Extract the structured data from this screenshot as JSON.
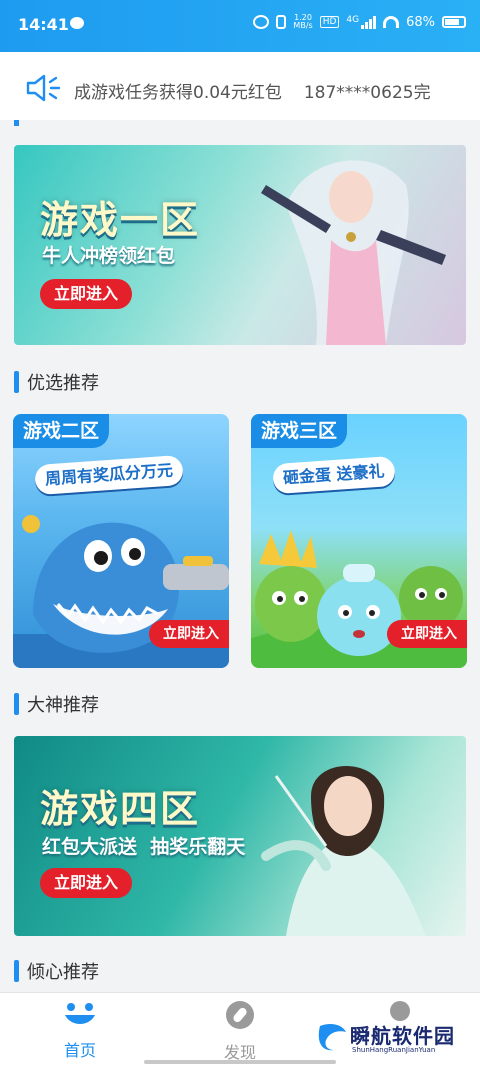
{
  "status_bar": {
    "time": "14:41",
    "speed_top": "1.20",
    "speed_bottom": "MB/s",
    "hd": "HD",
    "network": "4G",
    "battery": "68%"
  },
  "marquee": {
    "text_1": "成游戏任务获得0.04元红包",
    "text_2": "187****0625完"
  },
  "banner_1": {
    "title": "游戏一区",
    "subtitle": "牛人冲榜领红包",
    "button": "立即进入"
  },
  "section_1": {
    "label": "优选推荐"
  },
  "card_2": {
    "tag": "游戏二区",
    "slogan": "周周有奖瓜分万元",
    "button": "立即进入"
  },
  "card_3": {
    "tag": "游戏三区",
    "slogan": "砸金蛋 送豪礼",
    "button": "立即进入"
  },
  "section_2": {
    "label": "大神推荐"
  },
  "banner_4": {
    "title": "游戏四区",
    "subtitle": "红包大派送  抽奖乐翻天",
    "button": "立即进入"
  },
  "section_3": {
    "label": "倾心推荐"
  },
  "bottom_nav": {
    "home": "首页",
    "discover": "发现"
  },
  "watermark": {
    "text": "瞬航软件园",
    "sub": "ShunHangRuanJianYuan"
  },
  "colors": {
    "accent": "#1e8ef0",
    "status_bar": "#1e9bf0",
    "button_red": "#e4202a",
    "nav_active": "#1e8ef0",
    "nav_inactive": "#9a9a9a"
  }
}
